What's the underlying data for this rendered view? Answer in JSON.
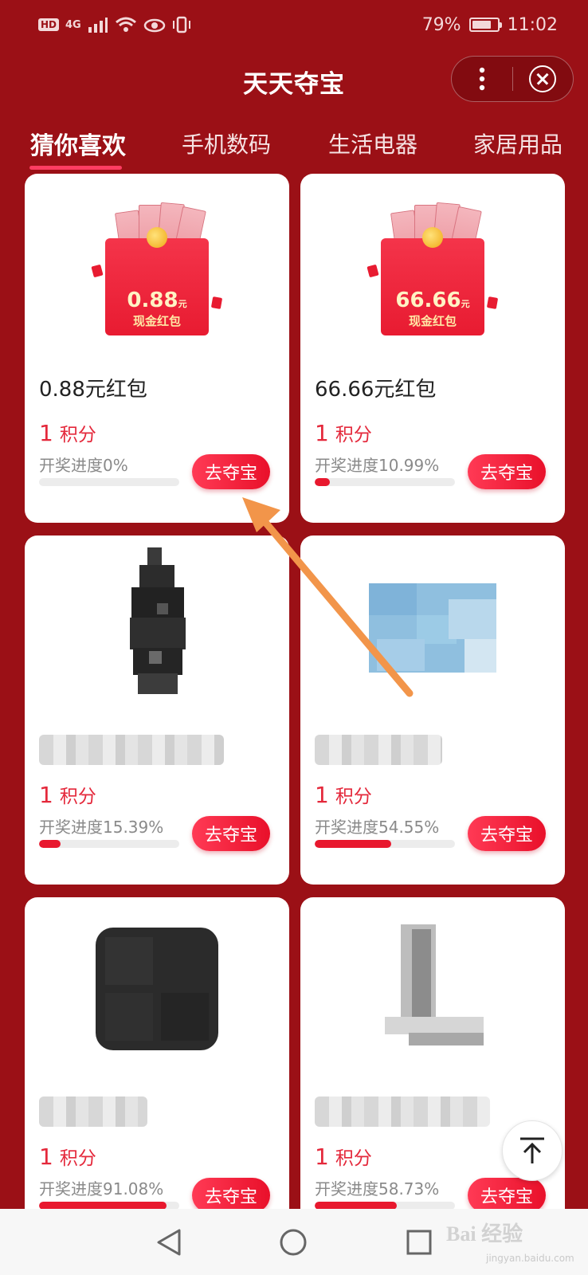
{
  "status_bar": {
    "network": "4G",
    "battery": "79%",
    "time": "11:02"
  },
  "title_bar": {
    "title": "天天夺宝",
    "more_icon": "more-vertical-icon",
    "close_icon": "close-circle-icon"
  },
  "tabs": [
    {
      "label": "猜你喜欢",
      "active": true
    },
    {
      "label": "手机数码",
      "active": false
    },
    {
      "label": "生活电器",
      "active": false
    },
    {
      "label": "家居用品",
      "active": false
    }
  ],
  "products": [
    {
      "title": "0.88元红包",
      "image_amount": "0.88",
      "image_unit": "元",
      "image_caption": "现金红包",
      "points_num": "1",
      "points_unit": "积分",
      "progress_label": "开奖进度0%",
      "progress": 0,
      "button": "去夺宝"
    },
    {
      "title": "66.66元红包",
      "image_amount": "66.66",
      "image_unit": "元",
      "image_caption": "现金红包",
      "points_num": "1",
      "points_unit": "积分",
      "progress_label": "开奖进度10.99%",
      "progress": 0.1099,
      "button": "去夺宝"
    },
    {
      "title": "",
      "points_num": "1",
      "points_unit": "积分",
      "progress_label": "开奖进度15.39%",
      "progress": 0.1539,
      "button": "去夺宝"
    },
    {
      "title": "",
      "points_num": "1",
      "points_unit": "积分",
      "progress_label": "开奖进度54.55%",
      "progress": 0.5455,
      "button": "去夺宝"
    },
    {
      "title": "",
      "points_num": "1",
      "points_unit": "积分",
      "progress_label": "开奖进度91.08%",
      "progress": 0.9108,
      "button": "去夺宝"
    },
    {
      "title": "",
      "points_num": "1",
      "points_unit": "积分",
      "progress_label": "开奖进度58.73%",
      "progress": 0.5873,
      "button": "去夺宝"
    }
  ],
  "back_to_top_icon": "arrow-up-to-top-icon",
  "nav_bar": {
    "back_icon": "triangle-back-icon",
    "home_icon": "circle-home-icon",
    "recents_icon": "square-recents-icon"
  },
  "watermark": {
    "text": "Bai 经验",
    "sub": "jingyan.baidu.com"
  },
  "colors": {
    "background": "#9b1016",
    "accent": "#e8182e",
    "points_text": "#e4283b",
    "tab_underline": "#ff3d62",
    "annotation_arrow": "#f2954a"
  }
}
